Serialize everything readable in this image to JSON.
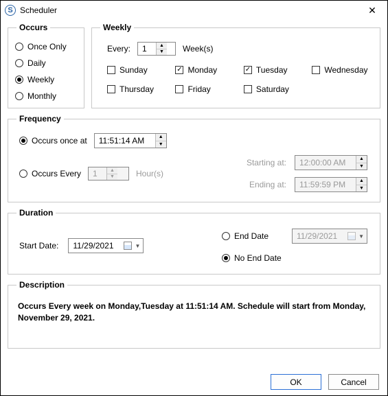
{
  "window": {
    "title": "Scheduler"
  },
  "occurs": {
    "legend": "Occurs",
    "options": {
      "once": "Once Only",
      "daily": "Daily",
      "weekly": "Weekly",
      "monthly": "Monthly"
    },
    "selected": "weekly"
  },
  "weekly": {
    "legend": "Weekly",
    "every_label": "Every:",
    "every_value": "1",
    "unit_label": "Week(s)",
    "days": {
      "sunday": {
        "label": "Sunday",
        "checked": false
      },
      "monday": {
        "label": "Monday",
        "checked": true
      },
      "tuesday": {
        "label": "Tuesday",
        "checked": true
      },
      "wednesday": {
        "label": "Wednesday",
        "checked": false
      },
      "thursday": {
        "label": "Thursday",
        "checked": false
      },
      "friday": {
        "label": "Friday",
        "checked": false
      },
      "saturday": {
        "label": "Saturday",
        "checked": false
      }
    }
  },
  "frequency": {
    "legend": "Frequency",
    "occurs_once_label": "Occurs once at",
    "occurs_once_time": "11:51:14 AM",
    "occurs_every_label": "Occurs Every",
    "occurs_every_value": "1",
    "occurs_every_unit": "Hour(s)",
    "starting_label": "Starting at:",
    "starting_value": "12:00:00 AM",
    "ending_label": "Ending at:",
    "ending_value": "11:59:59 PM",
    "selected": "once"
  },
  "duration": {
    "legend": "Duration",
    "start_date_label": "Start Date:",
    "start_date_value": "11/29/2021",
    "end_date_label": "End Date",
    "end_date_value": "11/29/2021",
    "no_end_date_label": "No End Date",
    "selected": "no_end"
  },
  "description": {
    "legend": "Description",
    "text": "Occurs Every week on Monday,Tuesday at 11:51:14 AM. Schedule will start from Monday, November 29, 2021."
  },
  "buttons": {
    "ok": "OK",
    "cancel": "Cancel"
  }
}
